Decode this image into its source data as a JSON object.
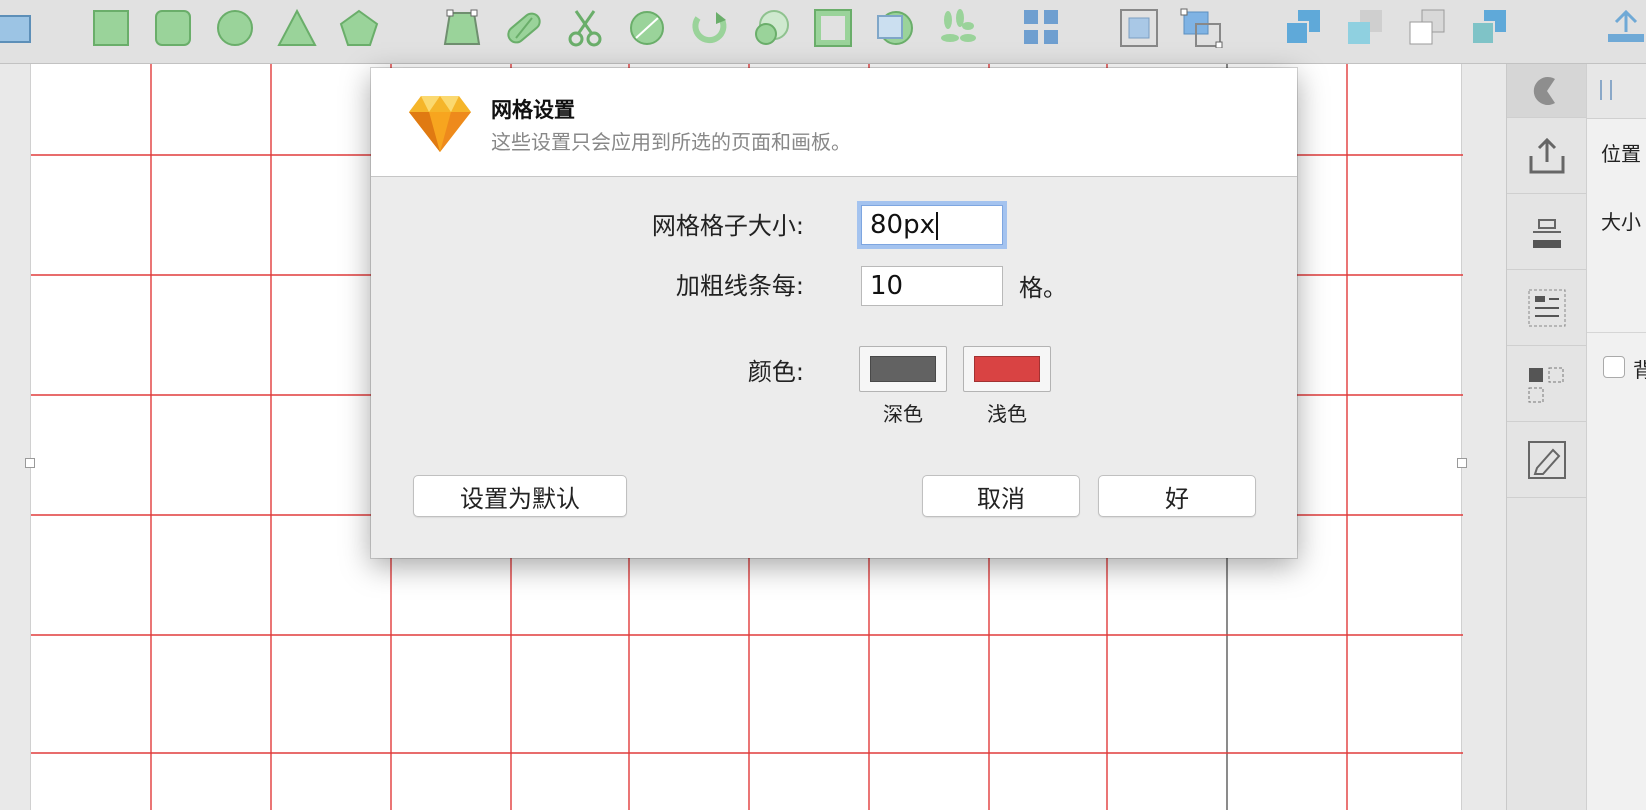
{
  "toolbar": {
    "icons": [
      "artboard-icon",
      "rectangle-icon",
      "rounded-rectangle-icon",
      "oval-icon",
      "triangle-icon",
      "polygon-icon",
      "transform-icon",
      "union-icon",
      "scissors-icon",
      "rotate-copies-icon",
      "rotate-icon",
      "offset-path-icon",
      "mask-icon",
      "flatten-icon",
      "scatter-icon",
      "grid-layout-icon",
      "frame-icon",
      "group-icon",
      "forward-icon",
      "backward-icon",
      "bring-front-icon",
      "send-back-icon",
      "upload-icon"
    ]
  },
  "canvas": {
    "grid_color": "#e03b3b",
    "grid_size_px": 80,
    "thick_line_color": "#5a5a5a"
  },
  "dialog": {
    "title": "网格设置",
    "subtitle": "这些设置只会应用到所选的页面和画板。",
    "grid_size_label": "网格格子大小:",
    "grid_size_value": "80px",
    "thick_lines_label": "加粗线条每:",
    "thick_lines_value": "10",
    "thick_lines_suffix": "格。",
    "colors_label": "颜色:",
    "dark_color": {
      "label": "深色",
      "hex": "#626262"
    },
    "light_color": {
      "label": "浅色",
      "hex": "#d94343"
    },
    "set_default_button": "设置为默认",
    "cancel_button": "取消",
    "ok_button": "好"
  },
  "inspector": {
    "position_label": "位置",
    "size_label": "大小",
    "bg_checkbox_label": "背"
  }
}
